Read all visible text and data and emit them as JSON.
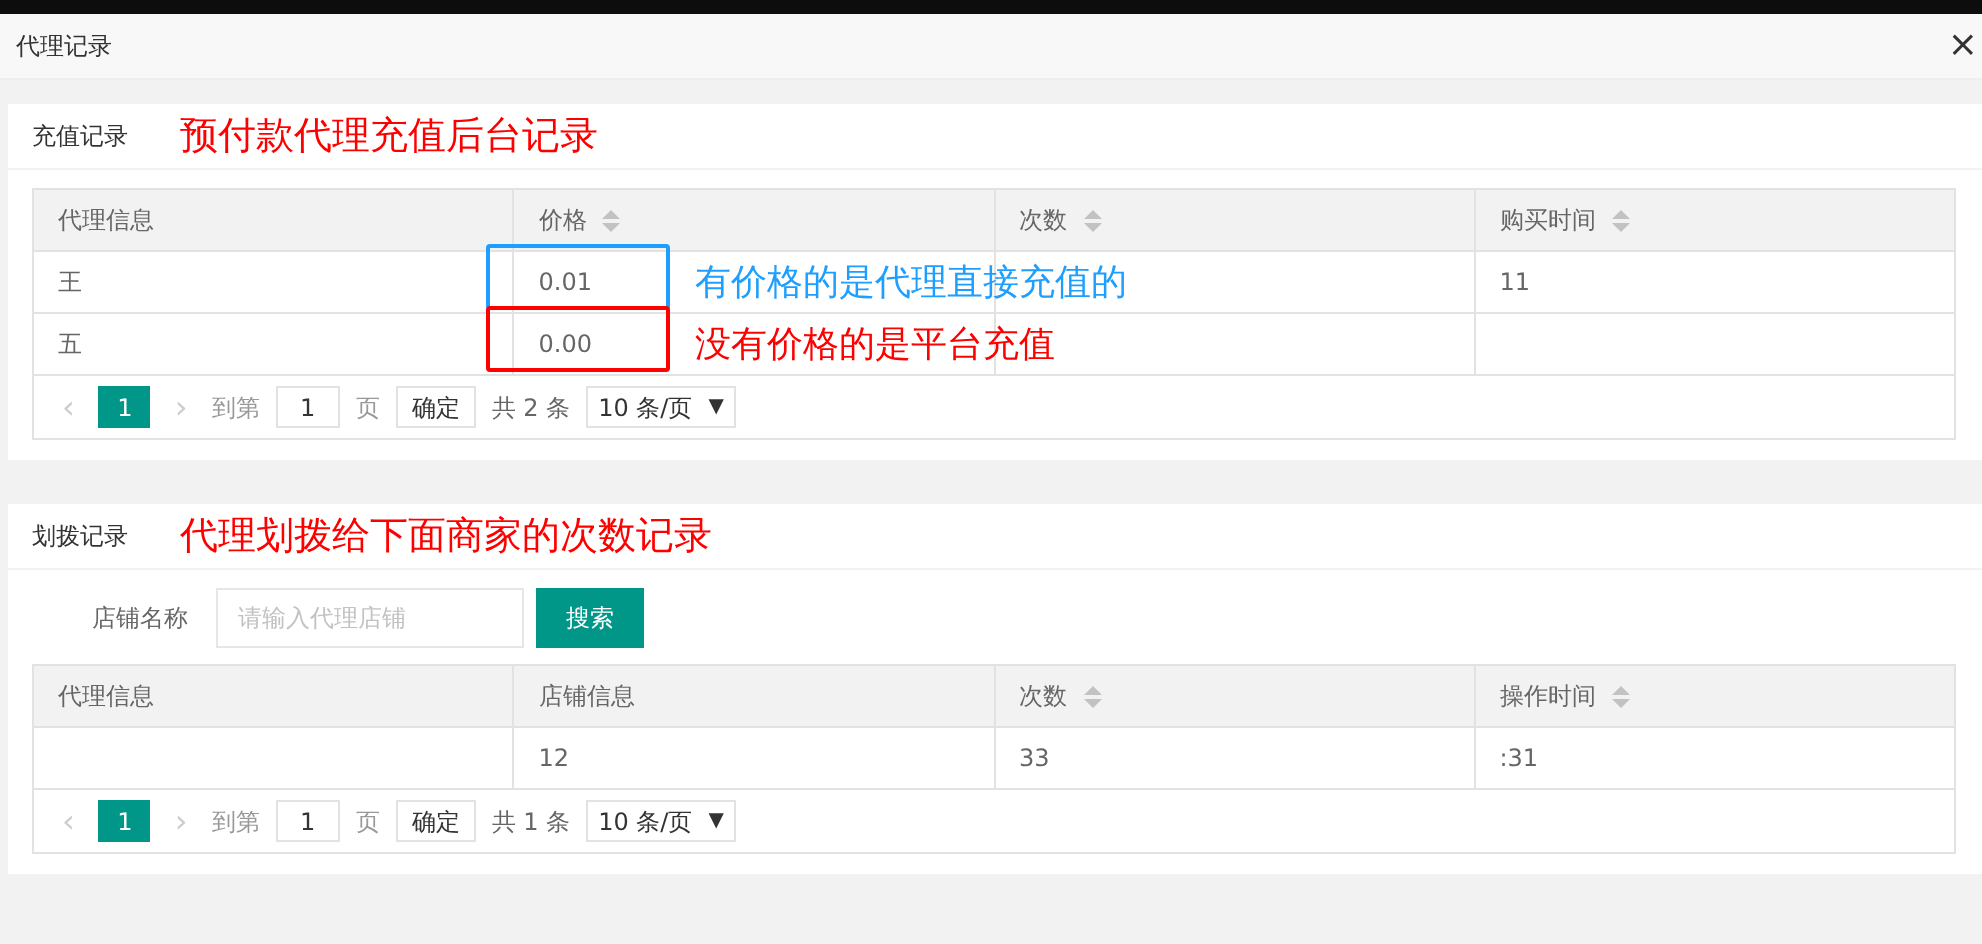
{
  "window": {
    "title": "代理记录",
    "close": "×"
  },
  "sections": [
    {
      "title": "充值记录",
      "note": "预付款代理充值后台记录",
      "columns": [
        {
          "label": "代理信息",
          "sortable": false
        },
        {
          "label": "价格",
          "sortable": true
        },
        {
          "label": "次数",
          "sortable": true
        },
        {
          "label": "购买时间",
          "sortable": true
        }
      ],
      "rows": [
        {
          "cells": [
            "王",
            "0.01",
            "",
            "11"
          ],
          "price_note": {
            "text": "有价格的是代理直接充值的",
            "color": "#1e9fff"
          }
        },
        {
          "cells": [
            "五",
            "0.00",
            "",
            ""
          ],
          "price_note": {
            "text": "没有价格的是平台充值",
            "color": "#ff0000"
          }
        }
      ],
      "pager": {
        "prev": "‹",
        "page": "1",
        "next": "›",
        "goto": "到第",
        "page_input": "1",
        "page_unit": "页",
        "confirm": "确定",
        "total": "共 2 条",
        "size": "10 条/页",
        "caret": "▼"
      }
    },
    {
      "title": "划拨记录",
      "note": "代理划拨给下面商家的次数记录",
      "search": {
        "label": "店铺名称",
        "placeholder": "请输入代理店铺",
        "button": "搜索"
      },
      "columns": [
        {
          "label": "代理信息",
          "sortable": false
        },
        {
          "label": "店铺信息",
          "sortable": false
        },
        {
          "label": "次数",
          "sortable": true
        },
        {
          "label": "操作时间",
          "sortable": true
        }
      ],
      "rows": [
        {
          "cells": [
            "",
            "12",
            "33",
            ":31"
          ]
        }
      ],
      "pager": {
        "prev": "‹",
        "page": "1",
        "next": "›",
        "goto": "到第",
        "page_input": "1",
        "page_unit": "页",
        "confirm": "确定",
        "total": "共 1 条",
        "size": "10 条/页",
        "caret": "▼"
      }
    }
  ]
}
